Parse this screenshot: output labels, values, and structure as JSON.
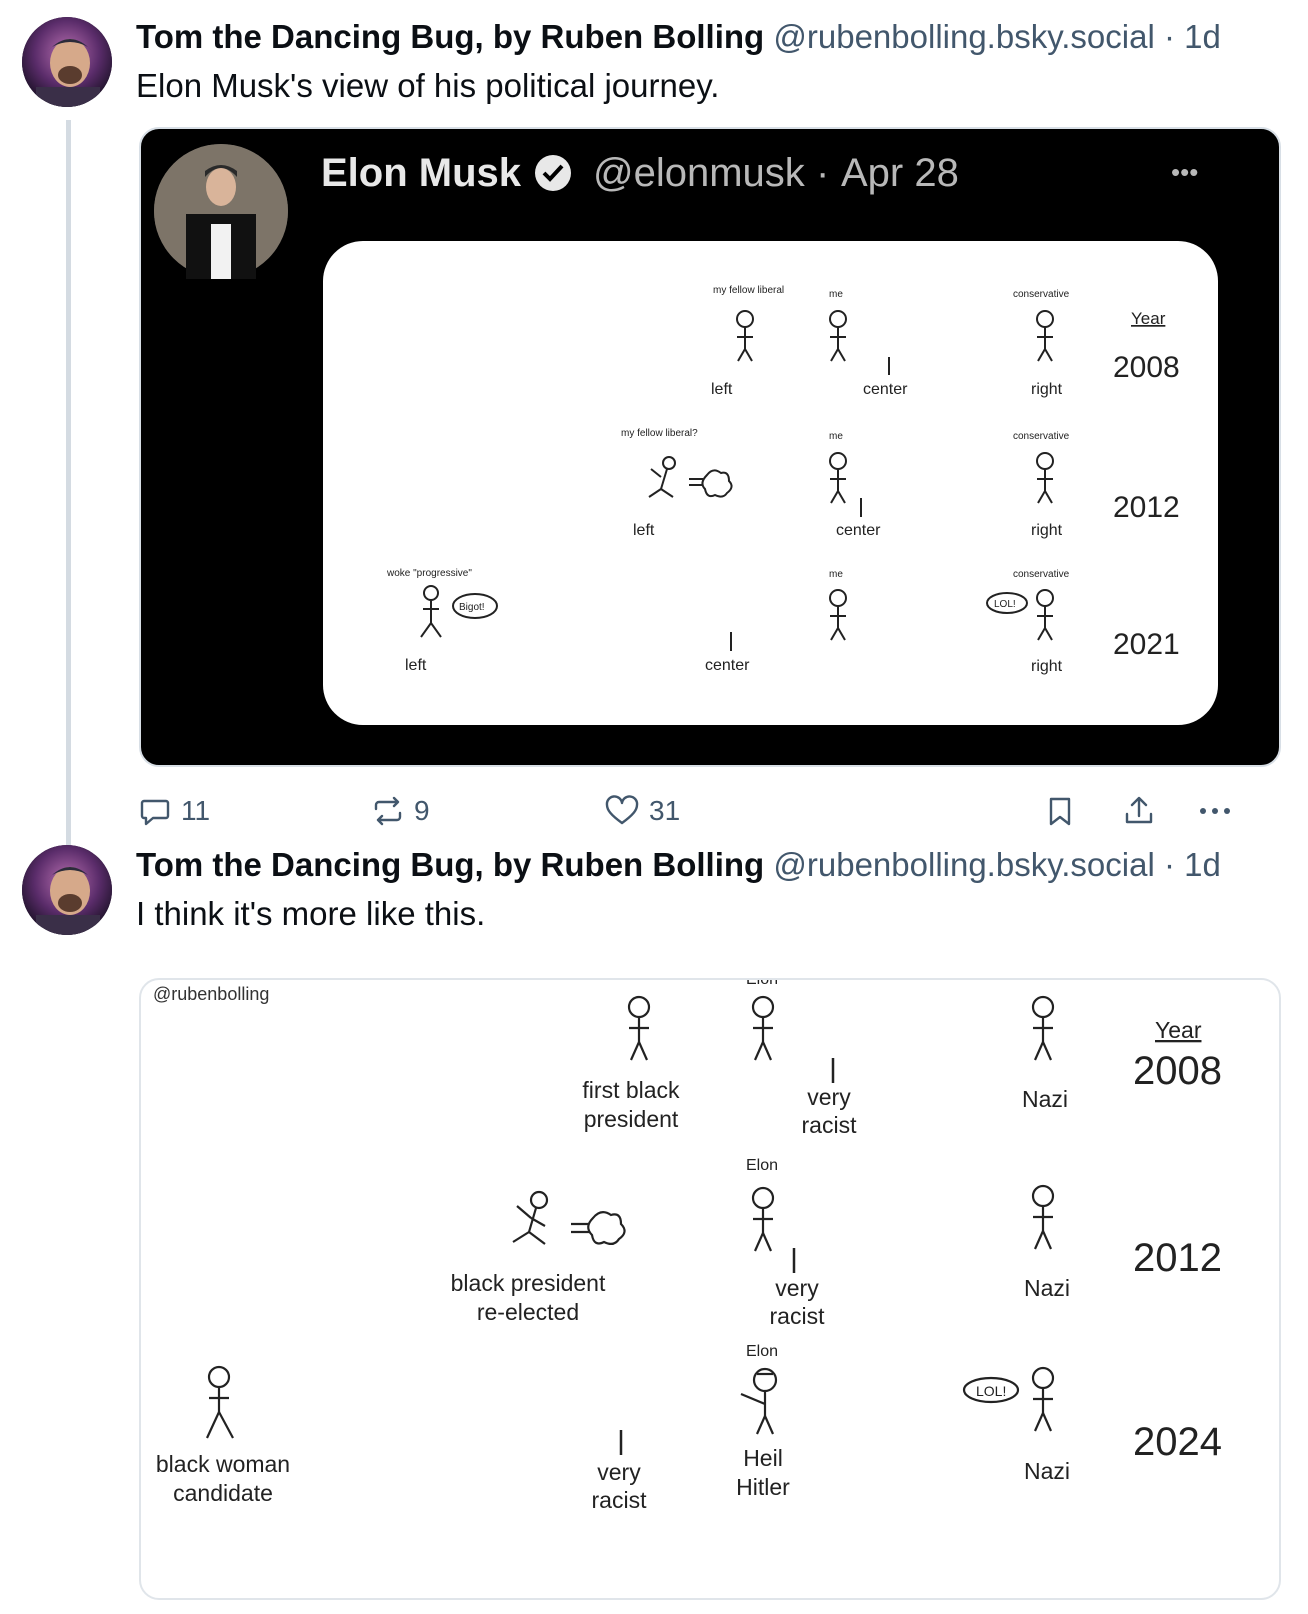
{
  "post1": {
    "author_name": "Tom the Dancing Bug, by Ruben Bolling",
    "handle": "@rubenbolling.bsky.social",
    "separator": "·",
    "age": "1d",
    "text": "Elon Musk's view of his political journey.",
    "embed": {
      "name": "Elon Musk",
      "handle": "@elonmusk",
      "separator": "·",
      "date": "Apr 28",
      "more": "•••",
      "year_header": "Year",
      "rows": [
        {
          "year": "2008",
          "left": "left",
          "center": "center",
          "right": "right",
          "fig_left": "my fellow liberal",
          "fig_me": "me",
          "fig_right": "conservative"
        },
        {
          "year": "2012",
          "left": "left",
          "center": "center",
          "right": "right",
          "fig_left": "my fellow liberal?",
          "fig_me": "me",
          "fig_right": "conservative"
        },
        {
          "year": "2021",
          "left": "left",
          "center": "center",
          "right": "right",
          "fig_left": "woke \"progressive\"",
          "fig_me": "me",
          "fig_right": "conservative",
          "bubble_left": "Bigot!",
          "bubble_right": "LOL!"
        }
      ]
    },
    "actions": {
      "replies": "11",
      "reposts": "9",
      "likes": "31"
    }
  },
  "post2": {
    "author_name": "Tom the Dancing Bug, by Ruben Bolling",
    "handle": "@rubenbolling.bsky.social",
    "separator": "·",
    "age": "1d",
    "text": "I think it's more like this.",
    "embed": {
      "watermark": "@rubenbolling",
      "year_header": "Year",
      "rows": [
        {
          "year": "2008",
          "fig_label": "Elon",
          "left_line1": "first black",
          "left_line2": "president",
          "mid_line1": "very",
          "mid_line2": "racist",
          "right": "Nazi"
        },
        {
          "year": "2012",
          "fig_label": "Elon",
          "left_line1": "black president",
          "left_line2": "re-elected",
          "mid_line1": "very",
          "mid_line2": "racist",
          "right": "Nazi"
        },
        {
          "year": "2024",
          "fig_label": "Elon",
          "left_line1": "black woman",
          "left_line2": "candidate",
          "mid_line1": "very",
          "mid_line2": "racist",
          "elon_line1": "Heil",
          "elon_line2": "Hitler",
          "right": "Nazi",
          "bubble_right": "LOL!"
        }
      ]
    }
  },
  "colors": {
    "text": "#0b0f14",
    "muted": "#42576c",
    "thread": "#d4dbe2",
    "blue": "#4a78c2",
    "red": "#d44040"
  }
}
